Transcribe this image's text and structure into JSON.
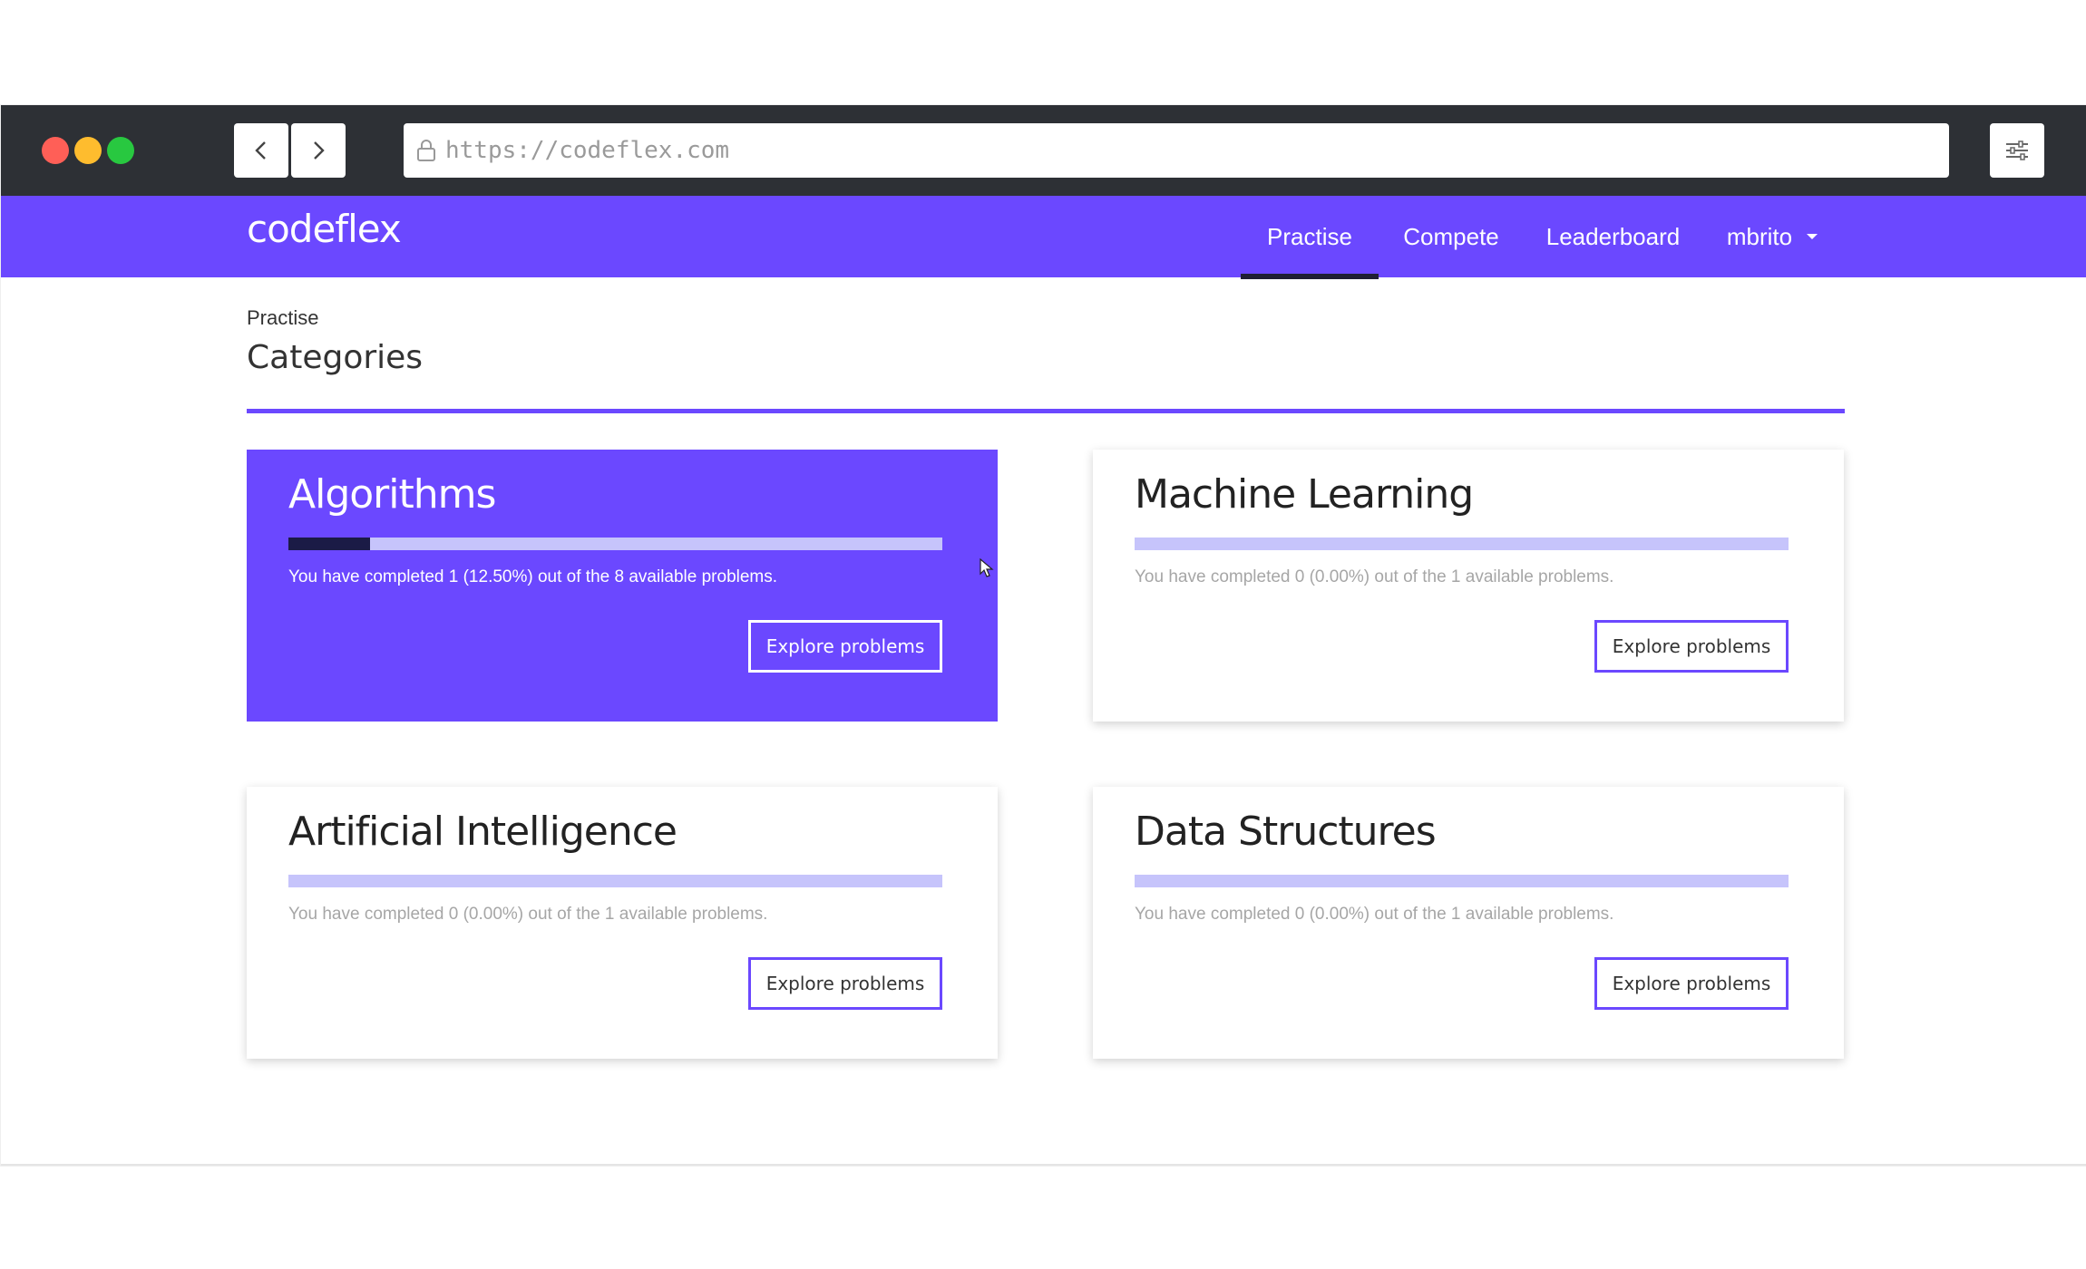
{
  "browser": {
    "url": "https://codeflex.com"
  },
  "nav": {
    "brand": "codeflex",
    "links": [
      "Practise",
      "Compete",
      "Leaderboard"
    ],
    "user": "mbrito"
  },
  "page": {
    "breadcrumb": "Practise",
    "title": "Categories"
  },
  "categories": [
    {
      "name": "Algorithms",
      "progress": 0.125,
      "description": "You have completed 1 (12.50%) out of the 8 available problems.",
      "button": "Explore problems",
      "active": true
    },
    {
      "name": "Machine Learning",
      "progress": 0,
      "description": "You have completed 0 (0.00%) out of the 1 available problems.",
      "button": "Explore problems",
      "active": false
    },
    {
      "name": "Artificial Intelligence",
      "progress": 0,
      "description": "You have completed 0 (0.00%) out of the 1 available problems.",
      "button": "Explore problems",
      "active": false
    },
    {
      "name": "Data Structures",
      "progress": 0,
      "description": "You have completed 0 (0.00%) out of the 1 available problems.",
      "button": "Explore problems",
      "active": false
    }
  ],
  "colors": {
    "brand": "#6b48ff",
    "progress_track": "#c6c4fb",
    "progress_fill": "#1b1b46",
    "chrome": "#2d3035"
  }
}
